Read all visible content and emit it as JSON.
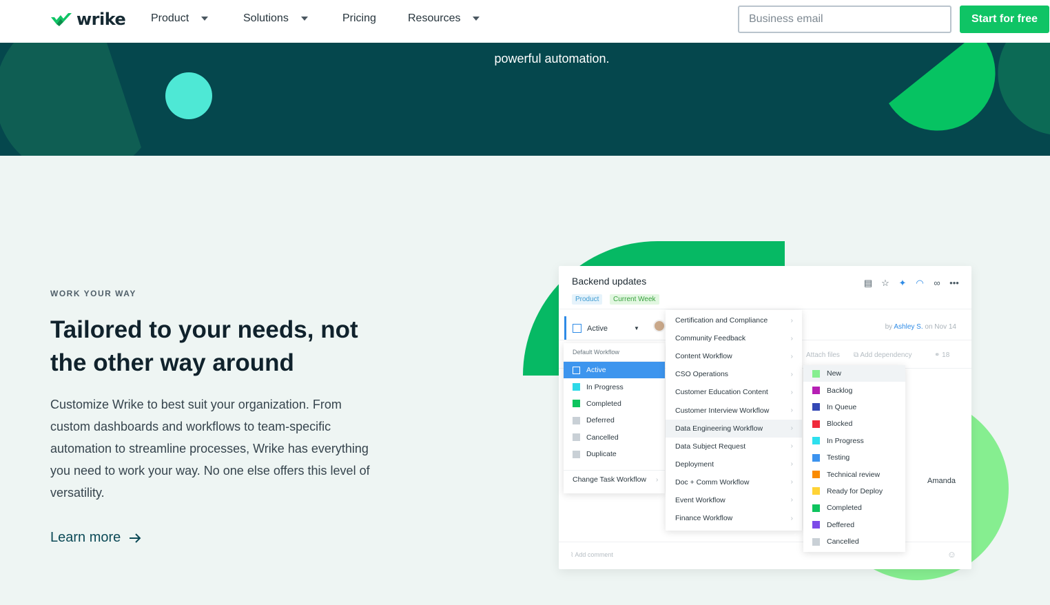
{
  "nav": {
    "logo": "wrike",
    "items": [
      {
        "label": "Product",
        "dropdown": true
      },
      {
        "label": "Solutions",
        "dropdown": true
      },
      {
        "label": "Pricing",
        "dropdown": false
      },
      {
        "label": "Resources",
        "dropdown": true
      }
    ],
    "email_placeholder": "Business email",
    "cta": "Start for free"
  },
  "hero": {
    "text": "powerful automation."
  },
  "section": {
    "eyebrow": "WORK YOUR WAY",
    "headline": "Tailored to your needs, not the other way around",
    "body": "Customize Wrike to best suit your organization. From custom dashboards and workflows to team-specific automation to streamline processes, Wrike has everything you need to work your way. No one else offers this level of versatility.",
    "learn_more": "Learn more"
  },
  "task": {
    "title": "Backend updates",
    "tags": [
      "Product",
      "Current Week"
    ],
    "status": "Active",
    "byline_prefix": "by",
    "byline_name": "Ashley S.",
    "byline_suffix": "on Nov 14",
    "attach": "Attach files",
    "dependency": "Add dependency",
    "share_count": "18",
    "assignee": "Amanda",
    "comment_placeholder": "Add comment"
  },
  "status_menu": {
    "header": "Default Workflow",
    "items": [
      {
        "label": "Active",
        "color": "#ffffff",
        "selected": true
      },
      {
        "label": "In Progress",
        "color": "#2ed9e8"
      },
      {
        "label": "Completed",
        "color": "#0ec45e"
      },
      {
        "label": "Deferred",
        "color": "#c9d0d6"
      },
      {
        "label": "Cancelled",
        "color": "#c9d0d6"
      },
      {
        "label": "Duplicate",
        "color": "#c9d0d6"
      }
    ],
    "change": "Change Task Workflow"
  },
  "workflow_menu": {
    "items": [
      "Certification and Compliance",
      "Community Feedback",
      "Content Workflow",
      "CSO Operations",
      "Customer Education Content",
      "Customer Interview Workflow",
      "Data Engineering Workflow",
      "Data Subject Request",
      "Deployment",
      "Doc + Comm Workflow",
      "Event Workflow",
      "Finance Workflow"
    ],
    "highlighted": 6
  },
  "stage_menu": {
    "items": [
      {
        "label": "New",
        "color": "#86ee90"
      },
      {
        "label": "Backlog",
        "color": "#b61fb4"
      },
      {
        "label": "In Queue",
        "color": "#3448b5"
      },
      {
        "label": "Blocked",
        "color": "#f02a3c"
      },
      {
        "label": "In Progress",
        "color": "#2ee0ee"
      },
      {
        "label": "Testing",
        "color": "#3c93ef"
      },
      {
        "label": "Technical review",
        "color": "#fa8b00"
      },
      {
        "label": "Ready for Deploy",
        "color": "#ffd336"
      },
      {
        "label": "Completed",
        "color": "#0ec45e"
      },
      {
        "label": "Deffered",
        "color": "#7c4ae8"
      },
      {
        "label": "Cancelled",
        "color": "#c9d0d6"
      }
    ]
  },
  "colors": {
    "brand_green": "#0fc465",
    "hero_bg": "#05474d",
    "section_bg": "#eef5f3"
  }
}
